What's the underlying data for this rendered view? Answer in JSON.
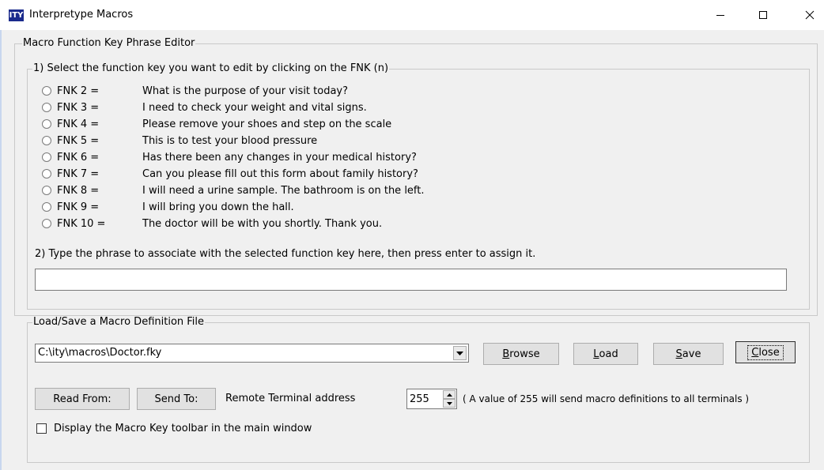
{
  "window": {
    "app_icon_text": "ITY",
    "title": "Interpretype Macros",
    "controls": {
      "minimize": "minimize-icon",
      "maximize": "maximize-icon",
      "close": "close-icon"
    }
  },
  "editor": {
    "group_title": "Macro Function Key Phrase Editor",
    "step1": {
      "title": "1) Select the function key you want to edit by clicking on the FNK (n)",
      "keys": [
        {
          "label": "FNK 2  =",
          "phrase": "What is the purpose of your visit today?"
        },
        {
          "label": "FNK 3  =",
          "phrase": "I need to check your weight and vital signs."
        },
        {
          "label": "FNK 4  =",
          "phrase": "Please remove your shoes and step on the scale"
        },
        {
          "label": "FNK 5  =",
          "phrase": "This is to test your blood pressure"
        },
        {
          "label": "FNK 6  =",
          "phrase": "Has there been any changes in your medical history?"
        },
        {
          "label": "FNK 7  =",
          "phrase": "Can you please fill out this form about family history?"
        },
        {
          "label": "FNK 8  =",
          "phrase": "I will need a urine sample. The bathroom is on the left."
        },
        {
          "label": "FNK 9  =",
          "phrase": "I will bring you down the hall."
        },
        {
          "label": "FNK 10 =",
          "phrase": "The doctor will be with you shortly. Thank you."
        }
      ]
    },
    "step2": {
      "instruction": "2) Type the phrase to associate with the selected function key here, then press enter to assign it.",
      "phrase_value": ""
    }
  },
  "file": {
    "group_title": "Load/Save a Macro Definition File",
    "path": "C:\\ity\\macros\\Doctor.fky",
    "buttons": {
      "browse_first": "B",
      "browse_rest": "rowse",
      "load_first": "L",
      "load_rest": "oad",
      "save_first": "S",
      "save_rest": "ave",
      "close_first": "C",
      "close_rest": "lose"
    },
    "read_from": "Read From:",
    "send_to": "Send To:",
    "terminal_label": "Remote Terminal address",
    "terminal_address": "255",
    "terminal_hint": "( A value of 255 will send macro definitions to all terminals )",
    "toolbar_checkbox": {
      "label": "Display the Macro Key toolbar in the main window",
      "checked": false
    }
  }
}
